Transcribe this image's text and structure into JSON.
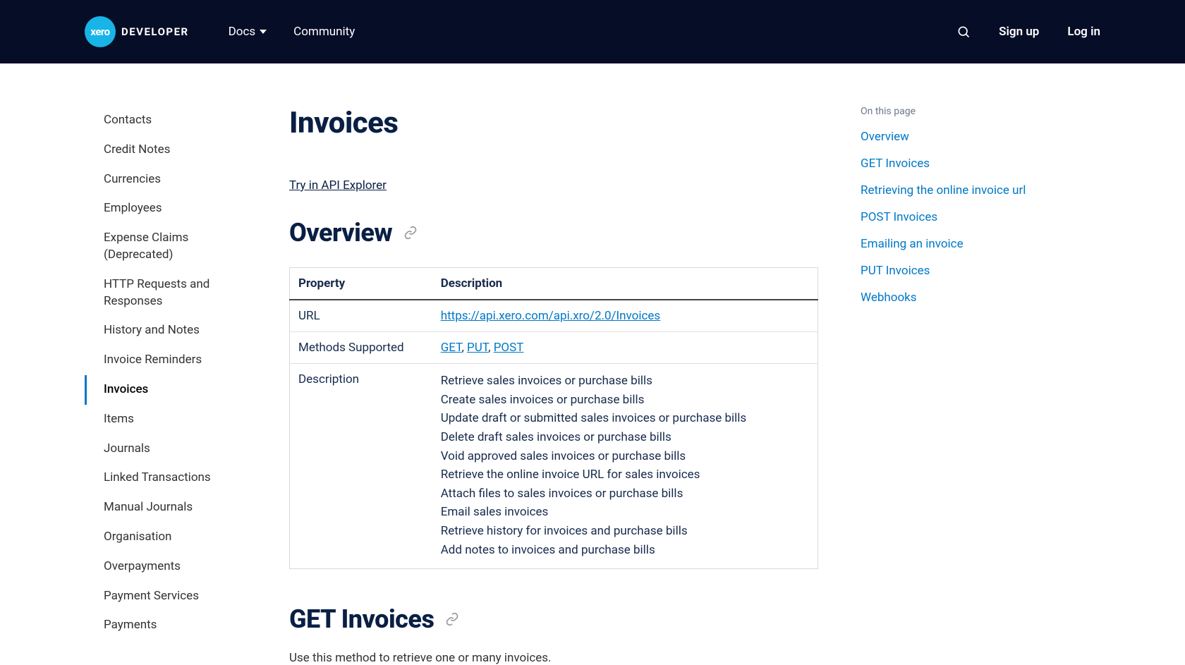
{
  "header": {
    "logo_badge": "xero",
    "logo_text": "DEVELOPER",
    "nav": {
      "docs": "Docs",
      "community": "Community"
    },
    "signup": "Sign up",
    "login": "Log in"
  },
  "sidebar": {
    "items": [
      "Contacts",
      "Credit Notes",
      "Currencies",
      "Employees",
      "Expense Claims (Deprecated)",
      "HTTP Requests and Responses",
      "History and Notes",
      "Invoice Reminders",
      "Invoices",
      "Items",
      "Journals",
      "Linked Transactions",
      "Manual Journals",
      "Organisation",
      "Overpayments",
      "Payment Services",
      "Payments"
    ],
    "active_index": 8
  },
  "main": {
    "title": "Invoices",
    "try_link": "Try in API Explorer",
    "overview": {
      "heading": "Overview",
      "table": {
        "headers": {
          "property": "Property",
          "description": "Description"
        },
        "rows": {
          "url": {
            "label": "URL",
            "value": "https://api.xero.com/api.xro/2.0/Invoices"
          },
          "methods": {
            "label": "Methods Supported",
            "values": [
              "GET",
              "PUT",
              "POST"
            ]
          },
          "description": {
            "label": "Description",
            "lines": [
              "Retrieve sales invoices or purchase bills",
              "Create sales invoices or purchase bills",
              "Update draft or submitted sales invoices or purchase bills",
              "Delete draft sales invoices or purchase bills",
              "Void approved sales invoices or purchase bills",
              "Retrieve the online invoice URL for sales invoices",
              "Attach files to sales invoices or purchase bills",
              "Email sales invoices",
              "Retrieve history for invoices and purchase bills",
              "Add notes to invoices and purchase bills"
            ]
          }
        }
      }
    },
    "get_section": {
      "heading": "GET Invoices",
      "description": "Use this method to retrieve one or many invoices."
    }
  },
  "toc": {
    "title": "On this page",
    "items": [
      "Overview",
      "GET Invoices",
      "Retrieving the online invoice url",
      "POST Invoices",
      "Emailing an invoice",
      "PUT Invoices",
      "Webhooks"
    ]
  }
}
